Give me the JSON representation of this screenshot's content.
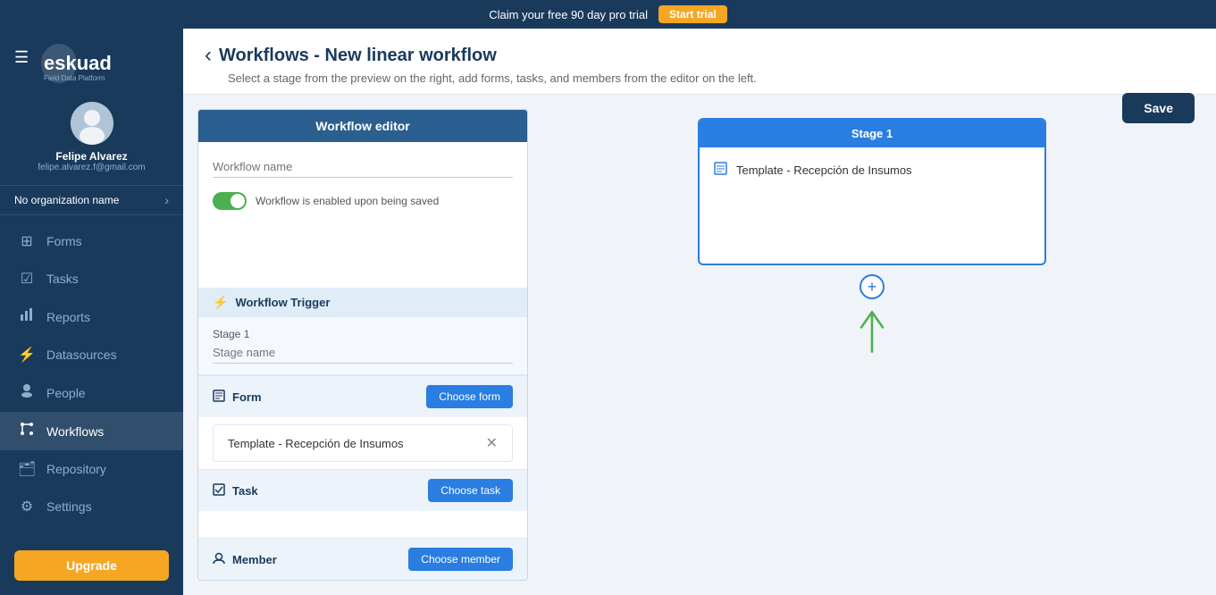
{
  "topBanner": {
    "text": "Claim your free 90 day pro trial",
    "buttonLabel": "Start trial"
  },
  "sidebar": {
    "hamburgerIcon": "☰",
    "logoAlt": "eskuad",
    "user": {
      "name": "Felipe Alvarez",
      "email": "felipe.alvarez.f@gmail.com",
      "avatarIcon": "👤"
    },
    "orgName": "No organization name",
    "chevronIcon": "›",
    "navItems": [
      {
        "id": "forms",
        "label": "Forms",
        "icon": "⊞"
      },
      {
        "id": "tasks",
        "label": "Tasks",
        "icon": "☑"
      },
      {
        "id": "reports",
        "label": "Reports",
        "icon": "📊"
      },
      {
        "id": "datasources",
        "label": "Datasources",
        "icon": "⚡"
      },
      {
        "id": "people",
        "label": "People",
        "icon": "👤"
      },
      {
        "id": "workflows",
        "label": "Workflows",
        "icon": "⚙"
      },
      {
        "id": "repository",
        "label": "Repository",
        "icon": "🗂"
      },
      {
        "id": "settings",
        "label": "Settings",
        "icon": "⚙"
      }
    ],
    "upgradeLabel": "Upgrade"
  },
  "pageHeader": {
    "backIcon": "‹",
    "title": "Workflows - New linear workflow",
    "subtitle": "Select a stage from the preview on the right, add forms, tasks, and members from the editor on the left.",
    "saveLabel": "Save"
  },
  "editor": {
    "headerLabel": "Workflow editor",
    "workflowNamePlaceholder": "Workflow name",
    "toggleLabel": "Workflow is enabled upon being saved",
    "triggerLabel": "Workflow Trigger",
    "triggerIcon": "⚡",
    "stageLabel": "Stage 1",
    "stageNamePlaceholder": "Stage name",
    "formSection": {
      "icon": "📋",
      "title": "Form",
      "chooseLabel": "Choose form",
      "selectedValue": "Template - Recepción de Insumos",
      "removeIcon": "✕"
    },
    "taskSection": {
      "icon": "☑",
      "title": "Task",
      "chooseLabel": "Choose task"
    },
    "memberSection": {
      "icon": "👤",
      "title": "Member",
      "chooseLabel": "Choose member"
    }
  },
  "stagePreview": {
    "stageCardHeader": "Stage 1",
    "stageIcon": "📋",
    "stageFormName": "Template - Recepción de Insumos",
    "addIcon": "+",
    "arrowColor": "#4caf50"
  }
}
